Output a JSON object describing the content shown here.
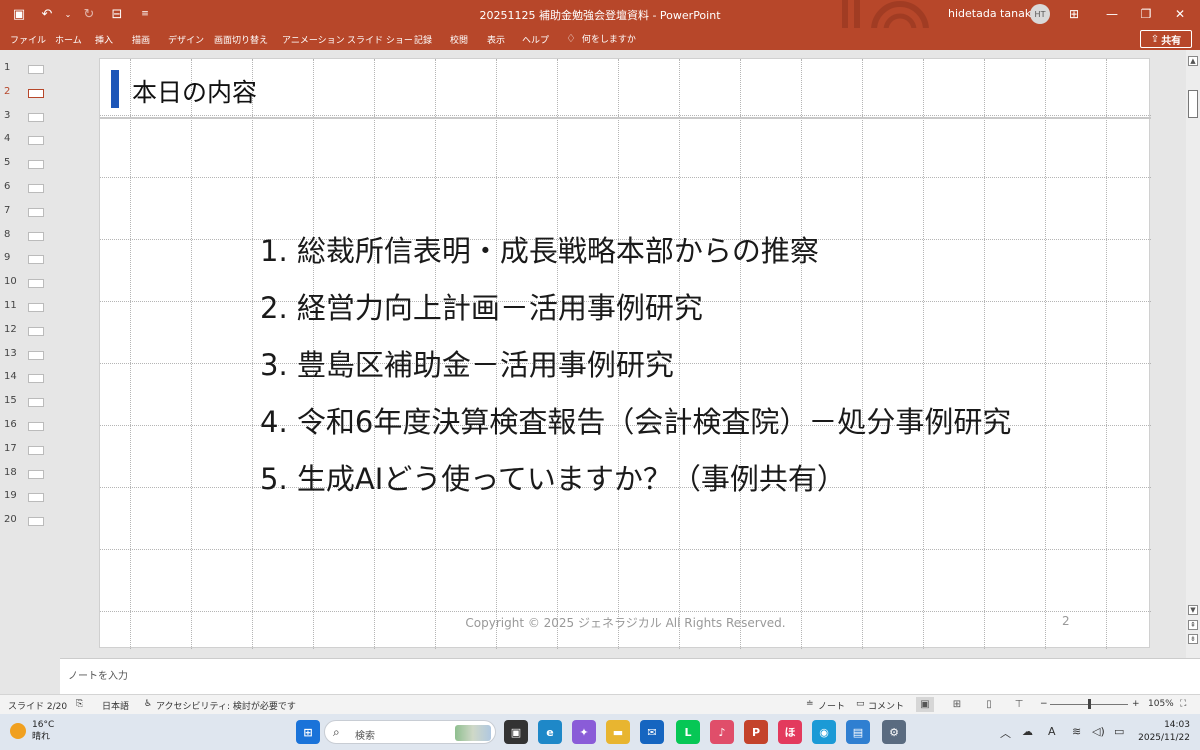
{
  "titlebar": {
    "doc_title": "20251125 補助金勉強会登壇資料 - PowerPoint",
    "user": "hidetada tanaka",
    "initials": "HT"
  },
  "ribbon": {
    "tabs": [
      "ファイル",
      "ホーム",
      "挿入",
      "描画",
      "デザイン",
      "画面切り替え",
      "アニメーション",
      "スライド ショー",
      "記録",
      "校閲",
      "表示",
      "ヘルプ"
    ],
    "tell_me": "何をしますか",
    "share": "共有"
  },
  "thumbnails": {
    "numbers": [
      "1",
      "2",
      "3",
      "4",
      "5",
      "6",
      "7",
      "8",
      "9",
      "10",
      "11",
      "12",
      "13",
      "14",
      "15",
      "16",
      "17",
      "18",
      "19",
      "20"
    ],
    "active_index": 1
  },
  "slide": {
    "title": "本日の内容",
    "items": [
      "1. 総裁所信表明・成長戦略本部からの推察",
      "2. 経営力向上計画－活用事例研究",
      "3. 豊島区補助金－活用事例研究",
      "4. 令和6年度決算検査報告（会計検査院）－処分事例研究",
      "5. 生成AIどう使っていますか？（事例共有）"
    ],
    "copyright": "Copyright © 2025 ジェネラジカル All Rights Reserved.",
    "page_number": "2",
    "accent_color": "#1d56b8"
  },
  "notes": {
    "placeholder": "ノートを入力"
  },
  "status": {
    "slide_pos": "スライド 2/20",
    "language": "日本語",
    "accessibility": "アクセシビリティ: 検討が必要です",
    "notes_btn": "ノート",
    "comments_btn": "コメント",
    "zoom_minus": "−",
    "zoom_plus": "+",
    "zoom": "105%",
    "zoom_level": 0.5
  },
  "taskbar": {
    "temp": "16°C",
    "weather": "晴れ",
    "search_placeholder": "検索",
    "time": "14:03",
    "date": "2025/11/22"
  },
  "colors": {
    "brand": "#b7472a"
  }
}
